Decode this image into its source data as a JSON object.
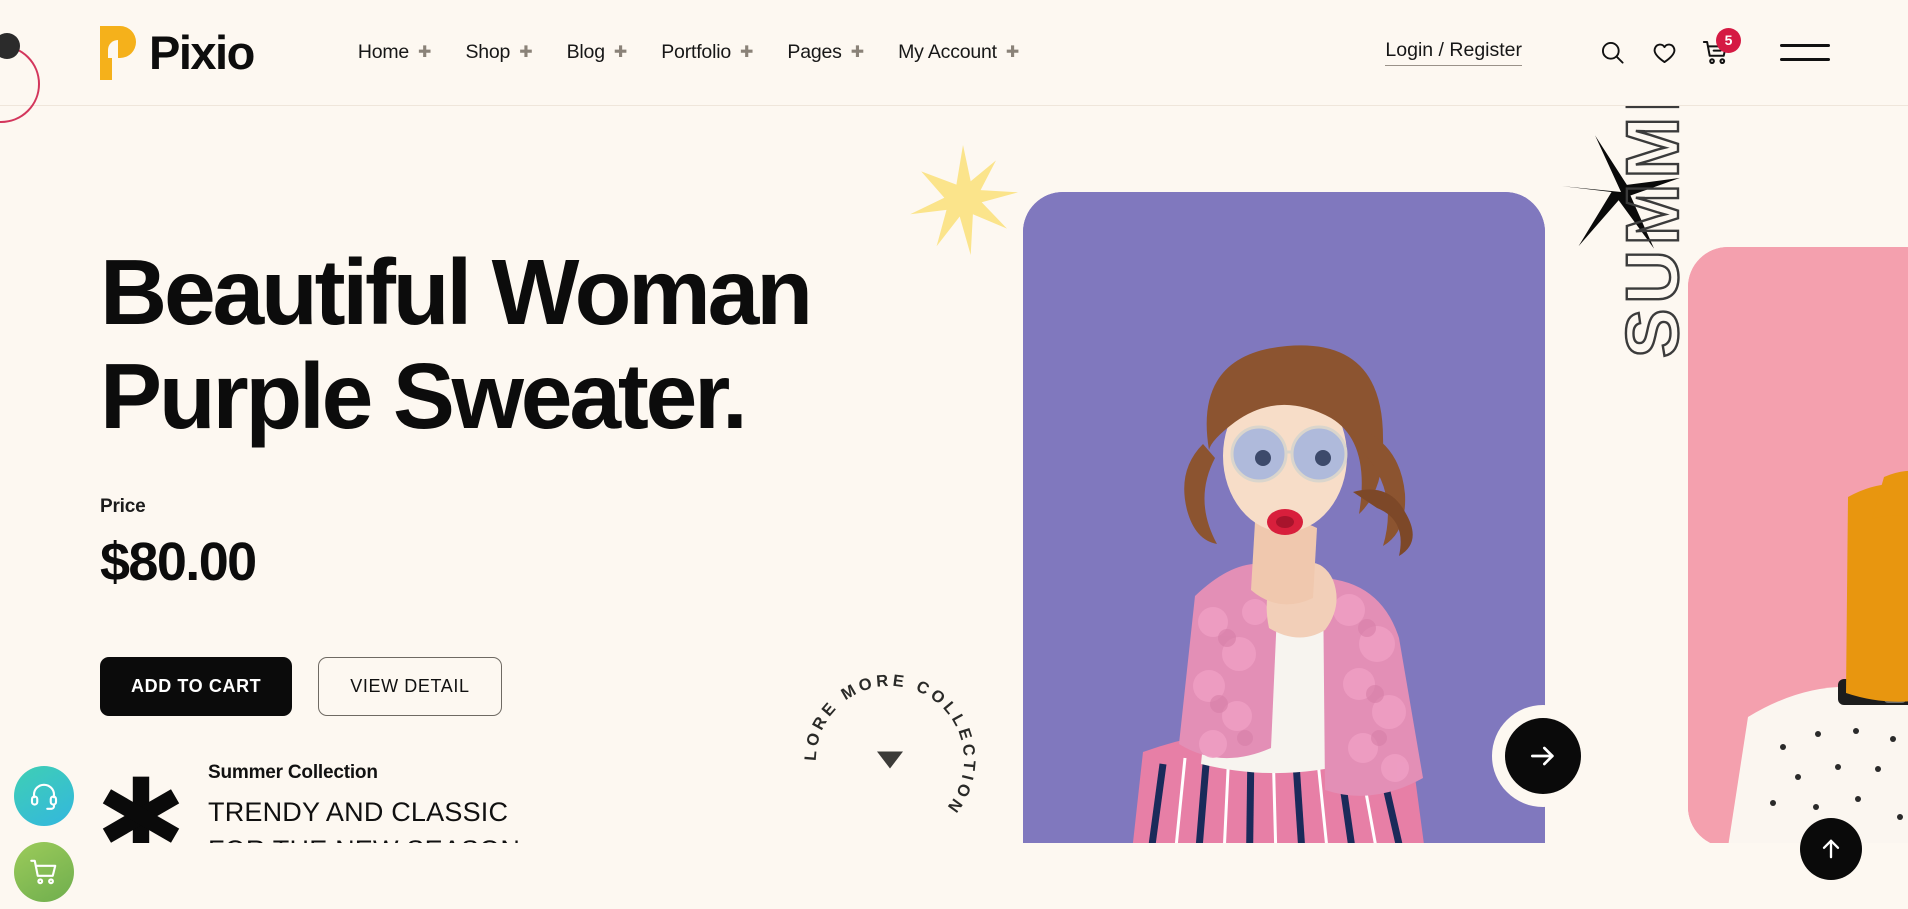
{
  "header": {
    "brand": "Pixio",
    "nav": [
      {
        "label": "Home",
        "icon": "sparkle-icon"
      },
      {
        "label": "Shop",
        "icon": "sparkle-icon"
      },
      {
        "label": "Blog",
        "icon": "sparkle-icon"
      },
      {
        "label": "Portfolio",
        "icon": "sparkle-icon"
      },
      {
        "label": "Pages",
        "icon": "sparkle-icon"
      },
      {
        "label": "My Account",
        "icon": "sparkle-icon"
      }
    ],
    "login": "Login / Register",
    "icons": {
      "search": "search-icon",
      "wishlist": "heart-icon",
      "cart": "cart-icon",
      "menu": "hamburger-icon"
    },
    "cart_count": "5"
  },
  "hero": {
    "title_line1": "Beautiful Woman",
    "title_line2": "Purple Sweater.",
    "price_label": "Price",
    "price_value": "$80.00",
    "add_to_cart": "ADD TO CART",
    "view_detail": "VIEW DETAIL",
    "collection_sub": "Summer Collection",
    "collection_line1": "TRENDY AND CLASSIC",
    "collection_line2": "FOR THE NEW SEASON",
    "explore_text": "EXPLORE MORE COLLECTION ",
    "explore_icon": "triangle-down-icon",
    "next_icon": "arrow-right-icon",
    "side_label": "SUMMER"
  },
  "widgets": {
    "support": "headset-icon",
    "quick_cart": "cart-icon",
    "scroll_top": "arrow-up-icon"
  },
  "colors": {
    "background": "#fdf8f1",
    "brand_yellow": "#f5b11b",
    "card_purple": "#8078be",
    "card_pink": "#f4a0ae",
    "badge_red": "#d51a43",
    "star_yellow": "#fbe48b",
    "ink": "#0c0c0c"
  }
}
